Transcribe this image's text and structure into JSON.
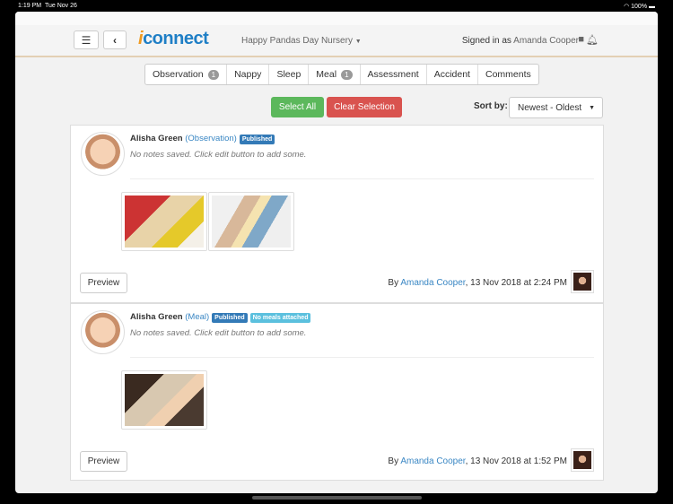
{
  "status_bar": {
    "time": "1:19 PM",
    "date": "Tue Nov 26",
    "battery": "100%"
  },
  "header": {
    "logo_prefix": "i",
    "logo_rest": "connect",
    "nursery": "Happy Pandas Day Nursery",
    "signed_in_label": "Signed in as",
    "user": "Amanda Cooper"
  },
  "tabs": [
    {
      "label": "Observation",
      "count": "1"
    },
    {
      "label": "Nappy"
    },
    {
      "label": "Sleep"
    },
    {
      "label": "Meal",
      "count": "1"
    },
    {
      "label": "Assessment"
    },
    {
      "label": "Accident"
    },
    {
      "label": "Comments"
    }
  ],
  "actions": {
    "select_all": "Select All",
    "clear_selection": "Clear Selection",
    "sort_label": "Sort by:",
    "sort_value": "Newest - Oldest"
  },
  "colors": {
    "green": "#5cb85c",
    "red": "#d9534f",
    "blue": "#337ab7",
    "info": "#5bc0de"
  },
  "entries": [
    {
      "name": "Alisha Green",
      "type": "(Observation)",
      "label": "Published",
      "notes": "No notes saved. Click edit button to add some.",
      "preview": "Preview",
      "by": "By",
      "author": "Amanda Cooper",
      "when": ", 13 Nov 2018 at 2:24 PM"
    },
    {
      "name": "Alisha Green",
      "type": "(Meal)",
      "label": "Published",
      "label2": "No meals attached",
      "notes": "No notes saved. Click edit button to add some.",
      "preview": "Preview",
      "by": "By",
      "author": "Amanda Cooper",
      "when": ", 13 Nov 2018 at 1:52 PM"
    }
  ]
}
